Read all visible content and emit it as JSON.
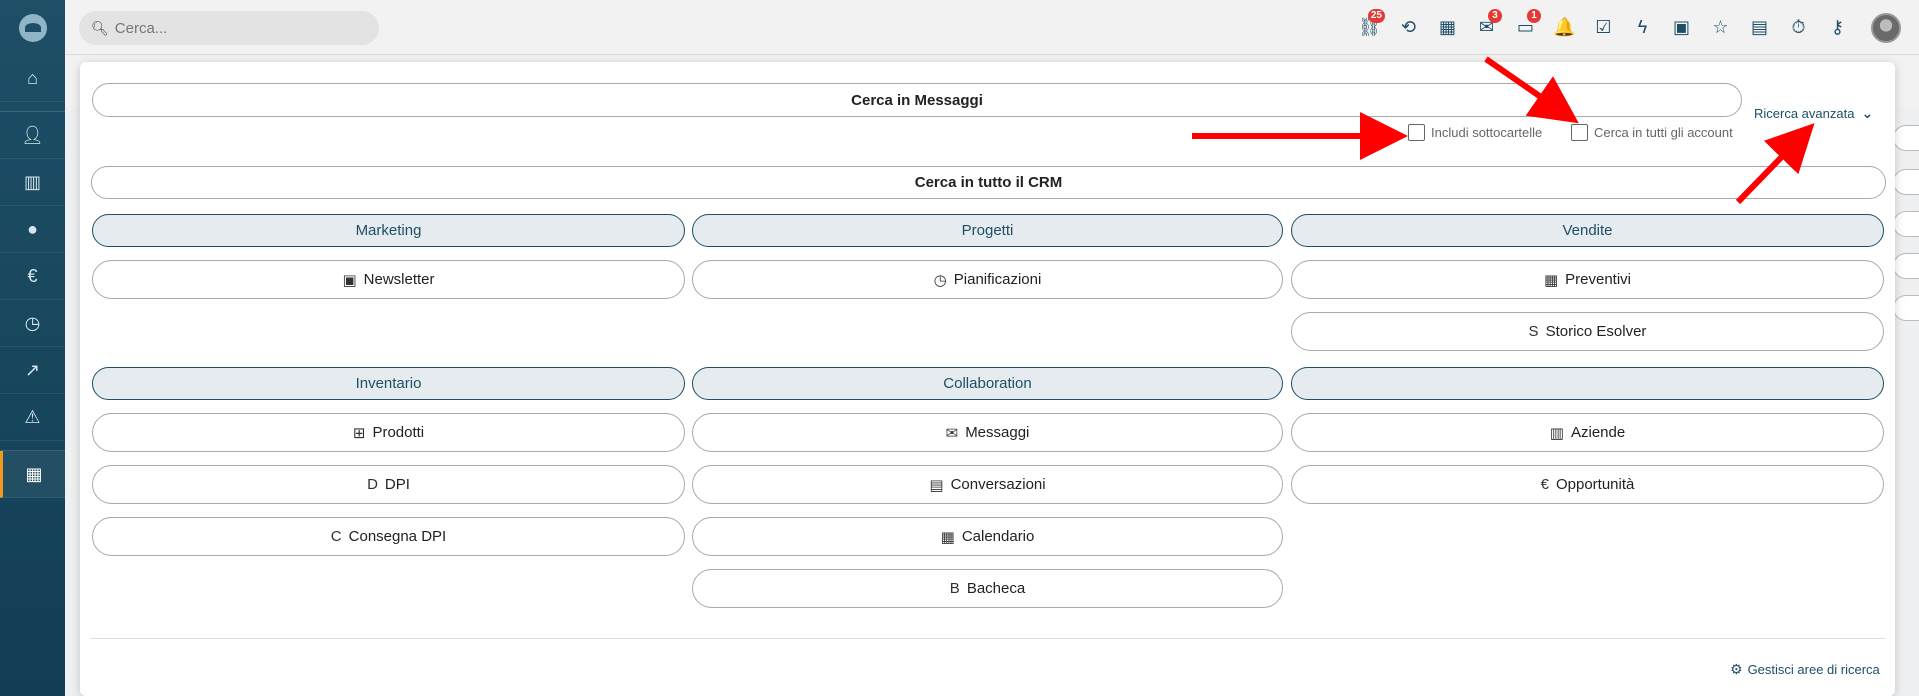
{
  "search": {
    "placeholder": "Cerca..."
  },
  "top_icons": [
    {
      "name": "org-chart-icon",
      "glyph": "⛓",
      "badge": "25"
    },
    {
      "name": "history-icon",
      "glyph": "⟲",
      "badge": ""
    },
    {
      "name": "calendar-icon",
      "glyph": "▦",
      "badge": ""
    },
    {
      "name": "mail-icon",
      "glyph": "✉",
      "badge": "3"
    },
    {
      "name": "chat-icon",
      "glyph": "▭",
      "badge": "1"
    },
    {
      "name": "bell-icon",
      "glyph": "🔔",
      "badge": ""
    },
    {
      "name": "task-check-icon",
      "glyph": "☑",
      "badge": ""
    },
    {
      "name": "lightning-icon",
      "glyph": "ϟ",
      "badge": ""
    },
    {
      "name": "contact-card-icon",
      "glyph": "▣",
      "badge": ""
    },
    {
      "name": "star-icon",
      "glyph": "☆",
      "badge": ""
    },
    {
      "name": "document-icon",
      "glyph": "▤",
      "badge": ""
    },
    {
      "name": "stopwatch-icon",
      "glyph": "⏱",
      "badge": ""
    },
    {
      "name": "key-icon",
      "glyph": "⚷",
      "badge": ""
    }
  ],
  "panel": {
    "search_messages": "Cerca in Messaggi",
    "include_subfolders": "Includi sottocartelle",
    "search_all_accounts": "Cerca in tutti gli account",
    "advanced_search": "Ricerca avanzata",
    "search_all_crm": "Cerca in tutto il CRM",
    "manage_areas": "Gestisci aree di ricerca"
  },
  "groups": {
    "marketing": {
      "title": "Marketing",
      "items": [
        {
          "label": "Newsletter",
          "icon": "newsletter-icon"
        }
      ]
    },
    "progetti": {
      "title": "Progetti",
      "items": [
        {
          "label": "Pianificazioni",
          "icon": "clock-icon"
        }
      ]
    },
    "vendite": {
      "title": "Vendite",
      "items": [
        {
          "label": "Preventivi",
          "icon": "calculator-icon"
        },
        {
          "label": "Storico Esolver",
          "letter": "S"
        }
      ]
    },
    "inventario": {
      "title": "Inventario",
      "items": [
        {
          "label": "Prodotti",
          "icon": "products-icon"
        },
        {
          "label": "DPI",
          "letter": "D"
        },
        {
          "label": "Consegna DPI",
          "letter": "C"
        }
      ]
    },
    "collaboration": {
      "title": "Collaboration",
      "items": [
        {
          "label": "Messaggi",
          "icon": "mail-icon"
        },
        {
          "label": "Conversazioni",
          "icon": "chat-icon"
        },
        {
          "label": "Calendario",
          "icon": "calendar-icon"
        },
        {
          "label": "Bacheca",
          "letter": "B"
        }
      ]
    },
    "unnamed": {
      "title": "",
      "items": [
        {
          "label": "Aziende",
          "icon": "building-icon"
        },
        {
          "label": "Opportunità",
          "icon": "euro-icon"
        }
      ]
    }
  },
  "letters": {
    "s": "S",
    "d": "D",
    "c": "C",
    "b": "B"
  },
  "colors": {
    "accent": "#1e4f66",
    "sidebar": "#123e55",
    "active_marker": "#f29a1f",
    "badge": "#e53935",
    "annotation_arrow": "#ff0000"
  }
}
